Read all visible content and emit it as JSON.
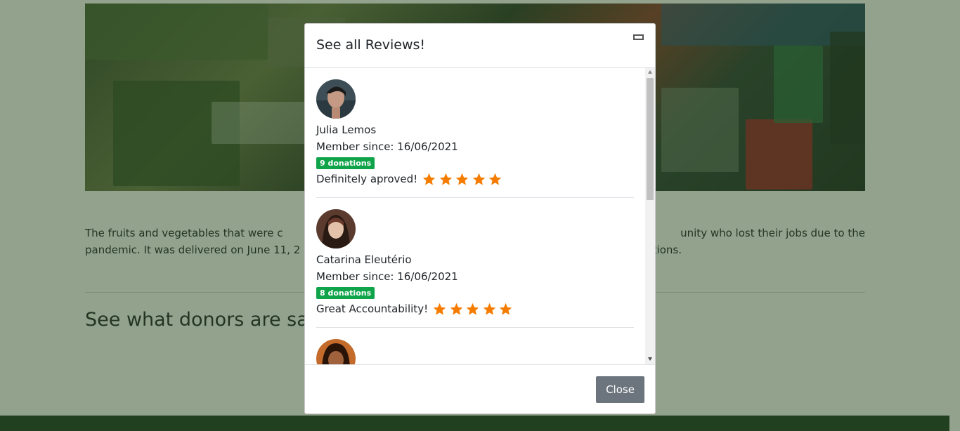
{
  "page": {
    "body_text_left": "The fruits and vegetables that were c",
    "body_text_right": "unity who lost their jobs due to the",
    "body_text_line2_left": "pandemic. It was delivered on June 11, 2",
    "body_text_line2_right": "tions.",
    "section_title": "See what donors are sayi"
  },
  "modal": {
    "title": "See all Reviews!",
    "close_label": "Close",
    "reviews": [
      {
        "name": "Julia Lemos",
        "member_since": "Member since: 16/06/2021",
        "donations": "9 donations",
        "text": "Definitely aproved!",
        "stars": 5
      },
      {
        "name": "Catarina Eleutério",
        "member_since": "Member since: 16/06/2021",
        "donations": "8 donations",
        "text": "Great Accountability!",
        "stars": 5
      }
    ]
  },
  "colors": {
    "star": "#f57c00",
    "badge": "#0fa34a",
    "close_button": "#6c757d",
    "backdrop": "#26461c"
  },
  "icons": {
    "minimize": "minimize-icon",
    "star": "star-icon"
  }
}
